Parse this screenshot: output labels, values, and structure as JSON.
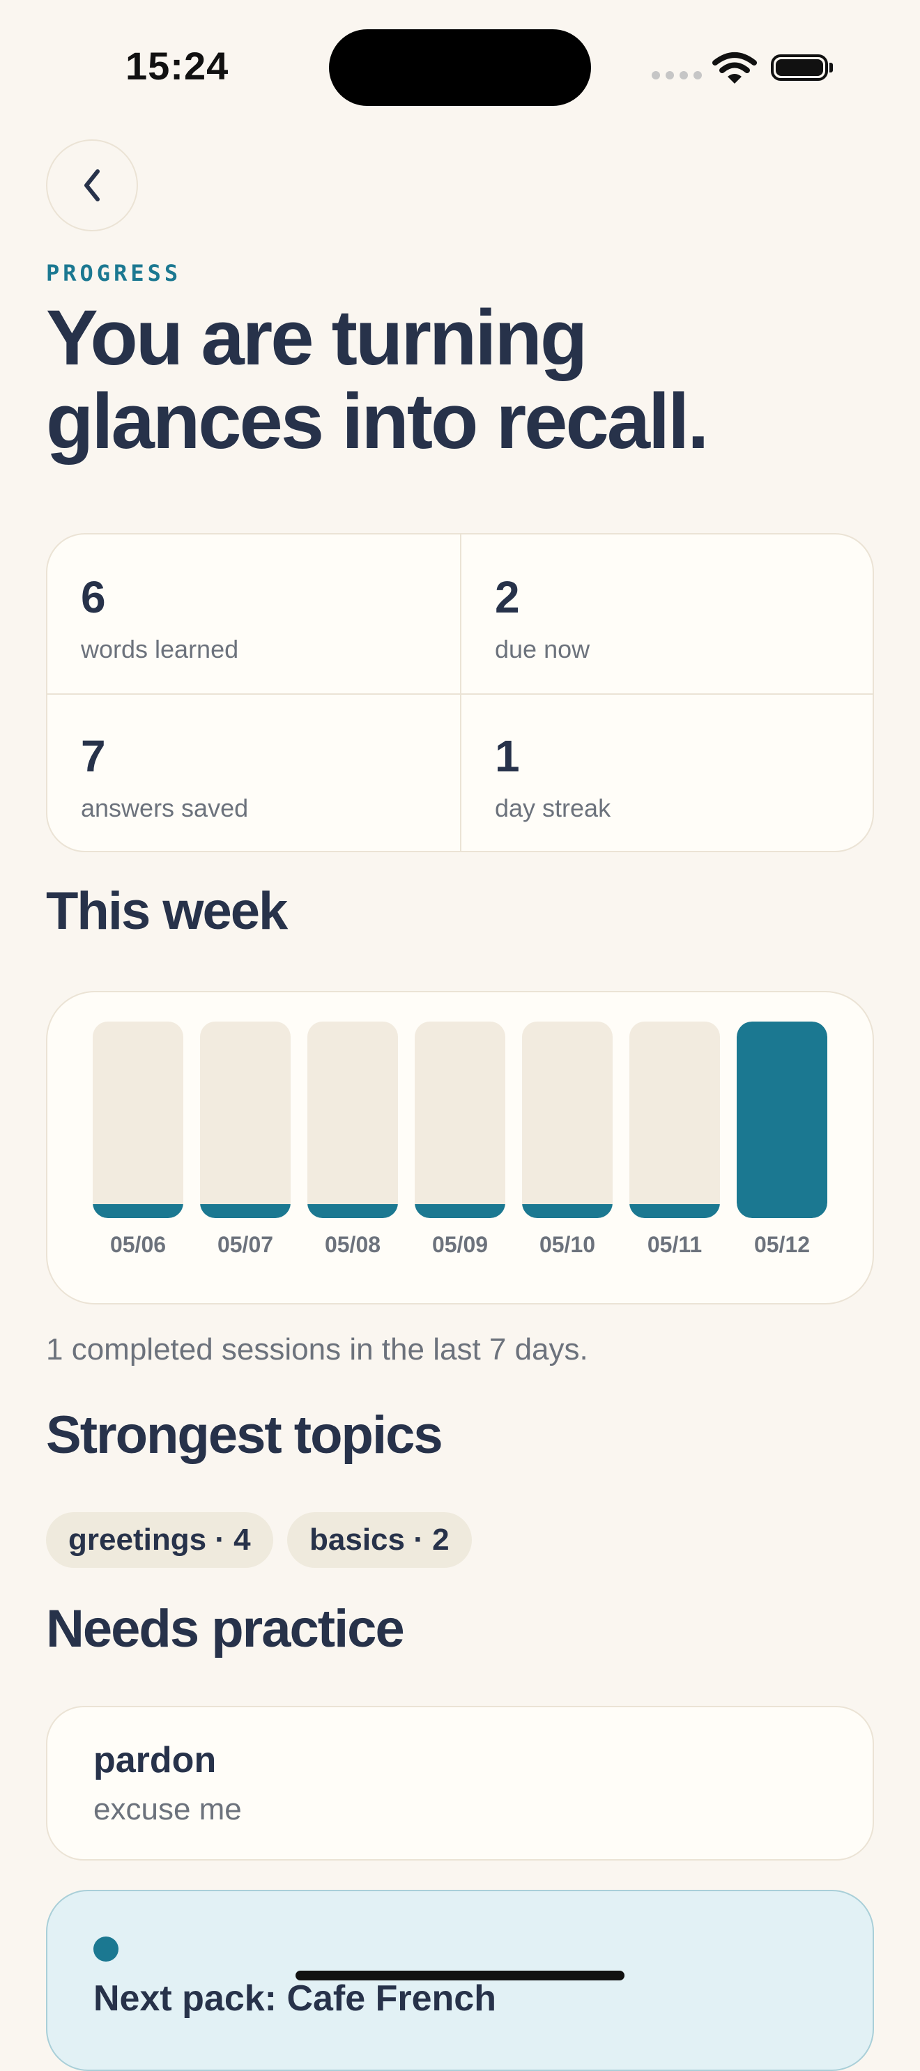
{
  "status_bar": {
    "time": "15:24"
  },
  "header": {
    "eyebrow": "PROGRESS",
    "headline_line1": "You are turning",
    "headline_line2": "glances into recall."
  },
  "stats": [
    {
      "value": "6",
      "label": "words learned"
    },
    {
      "value": "2",
      "label": "due now"
    },
    {
      "value": "7",
      "label": "answers saved"
    },
    {
      "value": "1",
      "label": "day streak"
    }
  ],
  "week": {
    "title": "This week",
    "caption": "1 completed sessions in the last 7 days.",
    "accent_color": "#1b7891"
  },
  "chart_data": {
    "type": "bar",
    "categories": [
      "05/06",
      "05/07",
      "05/08",
      "05/09",
      "05/10",
      "05/11",
      "05/12"
    ],
    "values": [
      0,
      0,
      0,
      0,
      0,
      0,
      1
    ],
    "ylim": [
      0,
      1
    ],
    "grid": false
  },
  "topics": {
    "title": "Strongest topics",
    "chips": [
      "greetings · 4",
      "basics · 2"
    ]
  },
  "needs_practice": {
    "title": "Needs practice",
    "items": [
      {
        "word": "pardon",
        "meaning": "excuse me"
      }
    ]
  },
  "next_pack": {
    "title": "Next pack: Cafe French"
  }
}
